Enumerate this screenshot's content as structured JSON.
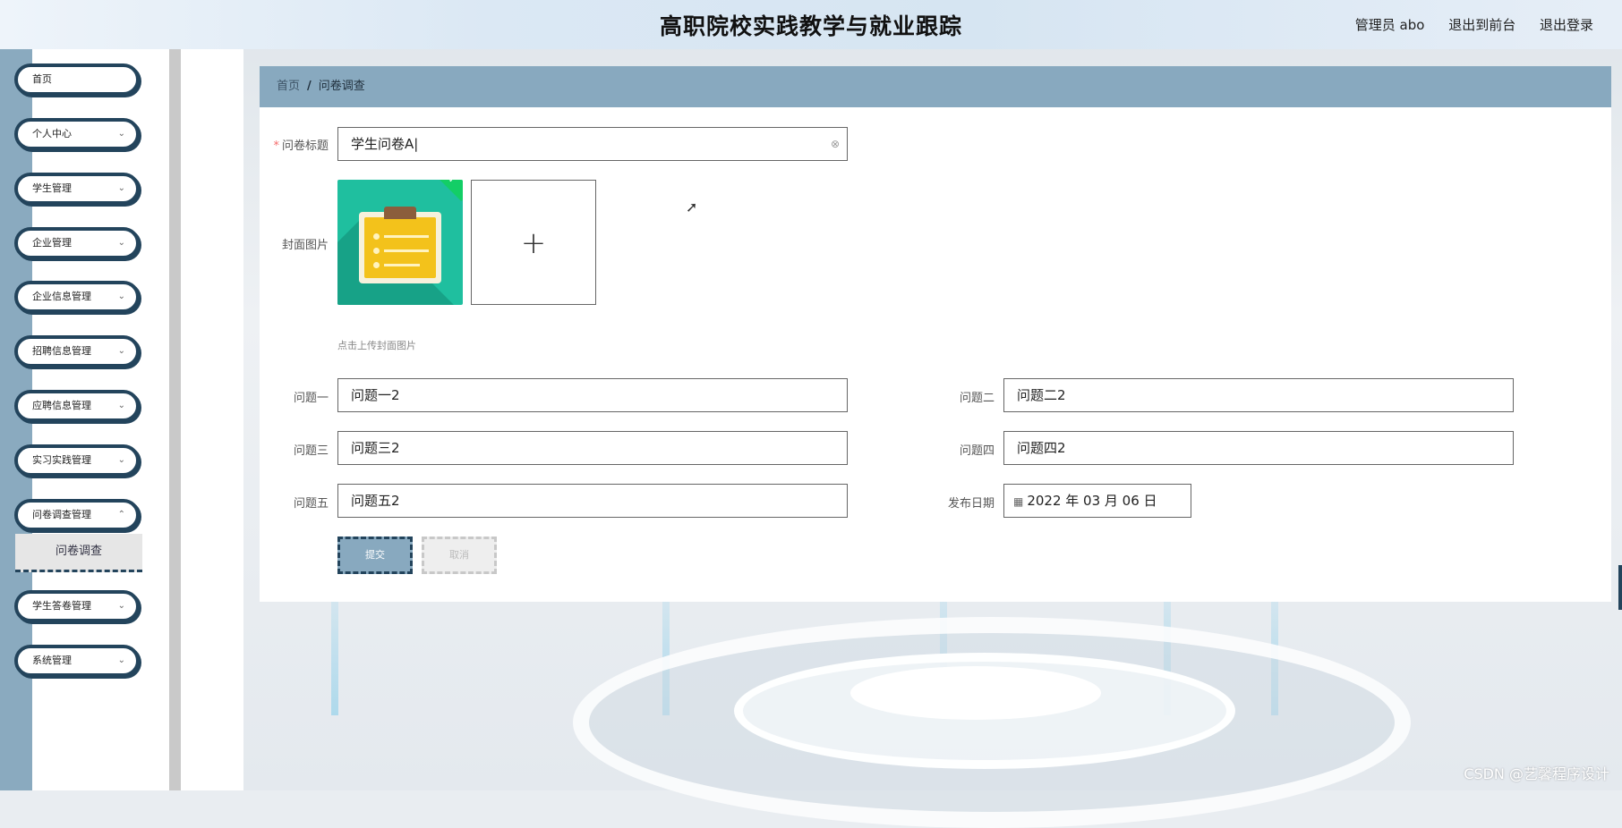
{
  "header": {
    "title": "高职院校实践教学与就业跟踪",
    "user": "管理员 abo",
    "front_link": "退出到前台",
    "logout_link": "退出登录"
  },
  "sidebar": {
    "items": [
      {
        "label": "首页"
      },
      {
        "label": "个人中心"
      },
      {
        "label": "学生管理"
      },
      {
        "label": "企业管理"
      },
      {
        "label": "企业信息管理"
      },
      {
        "label": "招聘信息管理"
      },
      {
        "label": "应聘信息管理"
      },
      {
        "label": "实习实践管理"
      },
      {
        "label": "问卷调查管理"
      },
      {
        "label": "学生答卷管理"
      },
      {
        "label": "系统管理"
      }
    ],
    "active_sub": "问卷调查"
  },
  "breadcrumb": {
    "home": "首页",
    "separator": "/",
    "current": "问卷调查"
  },
  "form": {
    "title_label": "问卷标题",
    "title_value": "学生问卷A",
    "cover_label": "封面图片",
    "upload_hint": "点击上传封面图片",
    "q1_label": "问题一",
    "q1_value": "问题一2",
    "q2_label": "问题二",
    "q2_value": "问题二2",
    "q3_label": "问题三",
    "q3_value": "问题三2",
    "q4_label": "问题四",
    "q4_value": "问题四2",
    "q5_label": "问题五",
    "q5_value": "问题五2",
    "date_label": "发布日期",
    "date_value": "2022 年 03 月 06 日",
    "submit": "提交",
    "cancel": "取消"
  },
  "watermark": "CSDN @艺馨程序设计",
  "colors": {
    "accent": "#88a9bf",
    "dark": "#23445c",
    "required": "#f56c6c",
    "success": "#13ce66"
  }
}
